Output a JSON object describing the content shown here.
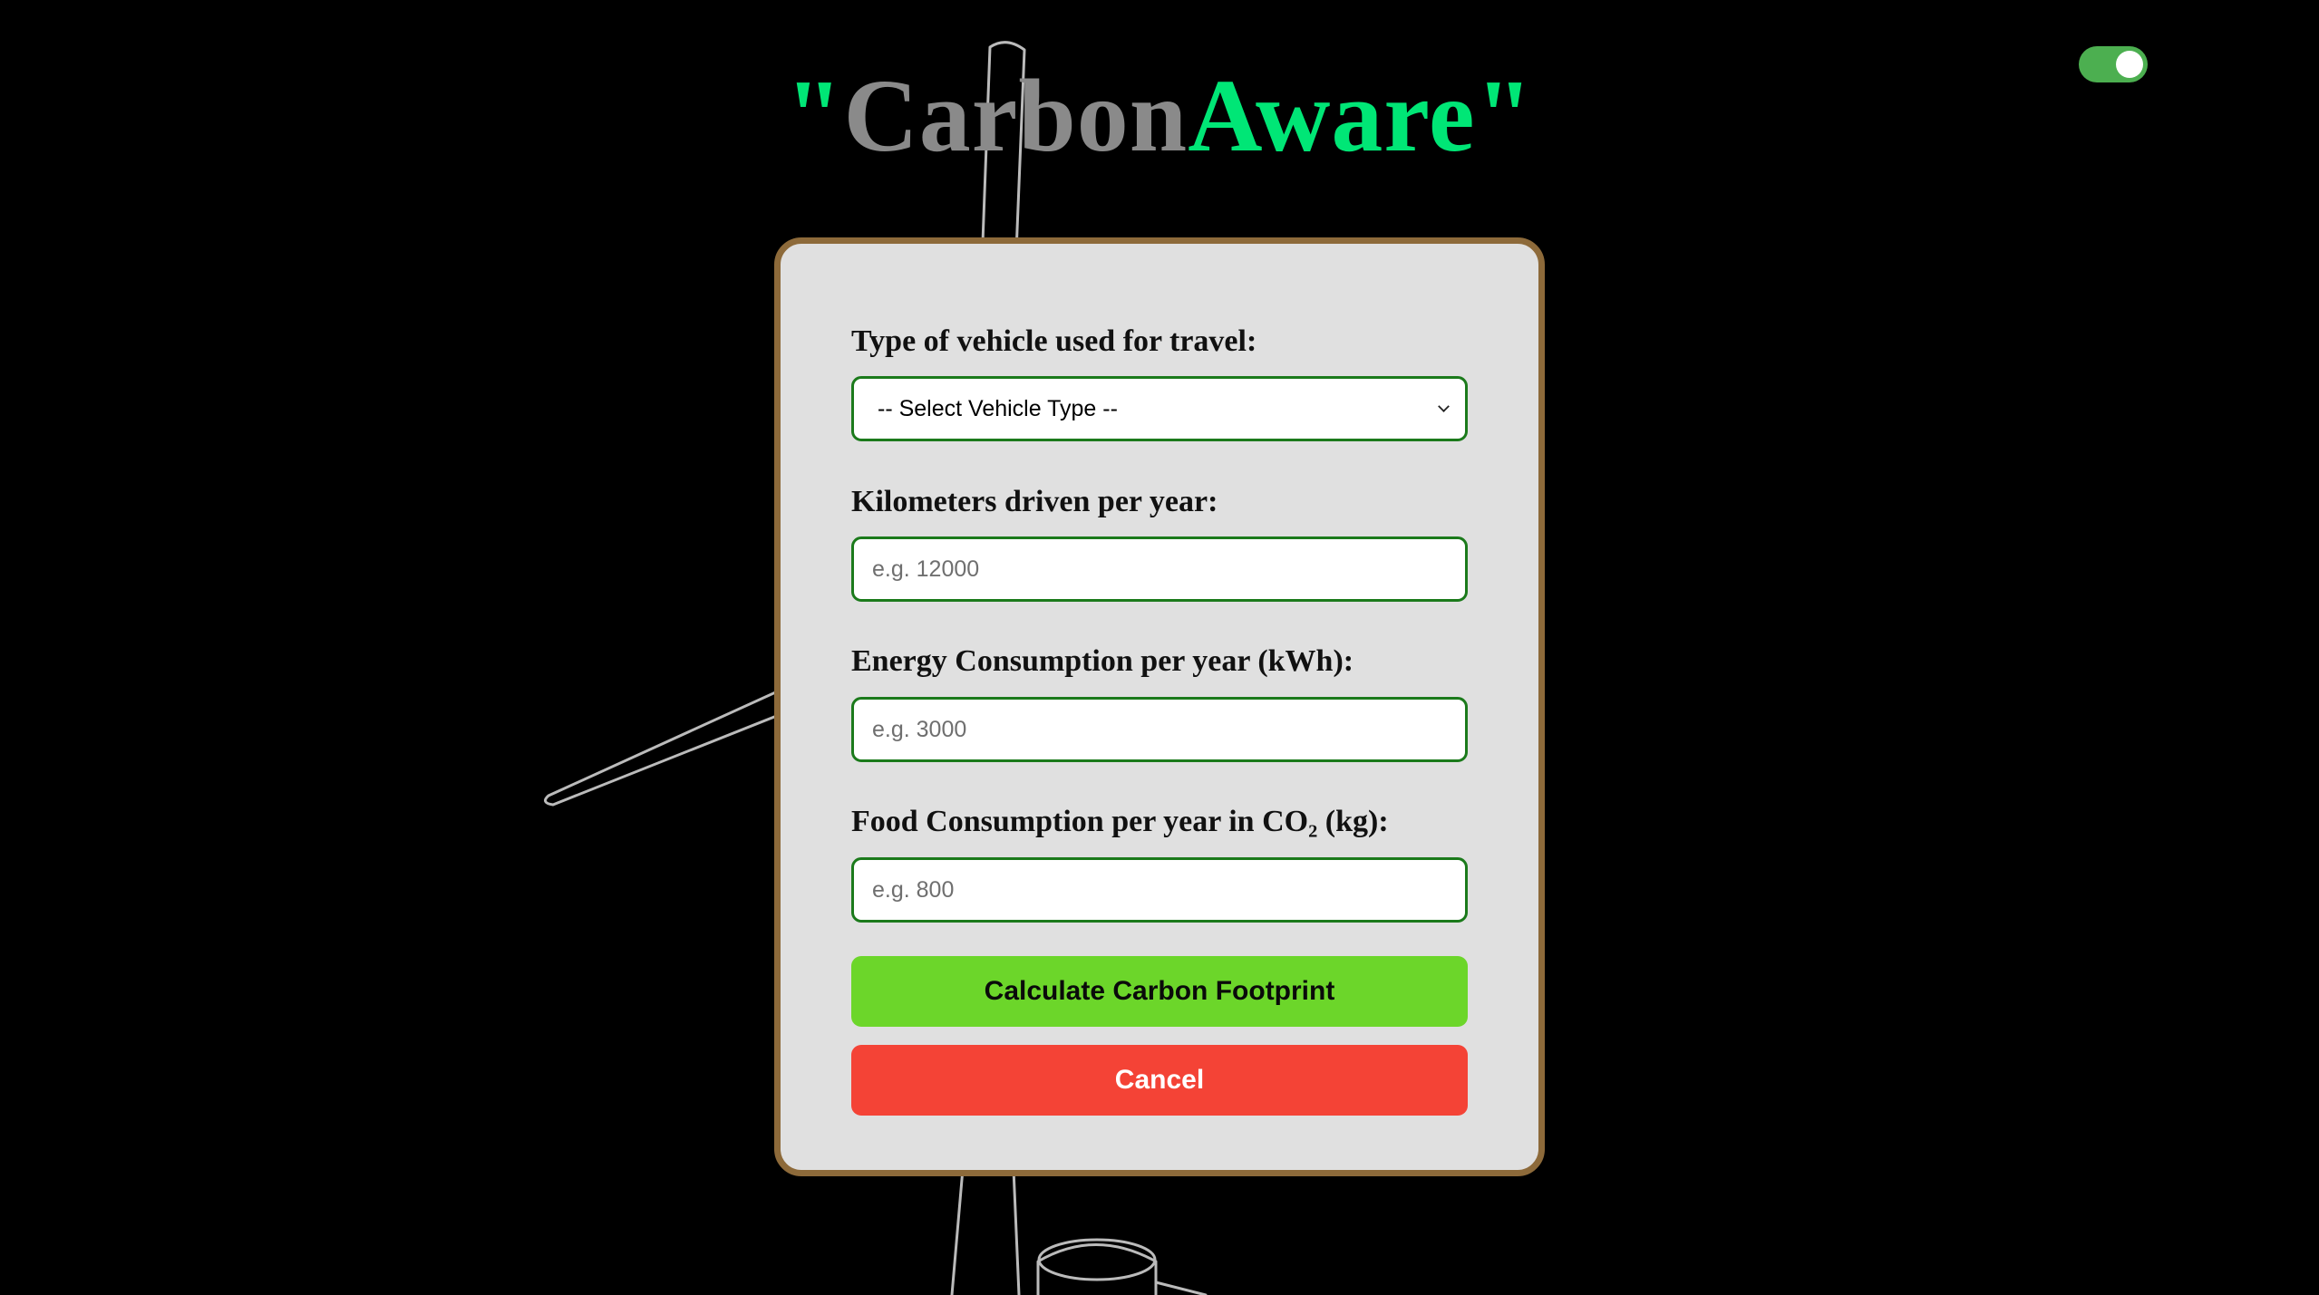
{
  "header": {
    "open_quote": "\"",
    "title_part1": "Carbon",
    "title_part2": "Aware",
    "close_quote": "\""
  },
  "theme_toggle": {
    "on": true
  },
  "form": {
    "vehicle": {
      "label": "Type of vehicle used for travel:",
      "selected": "-- Select Vehicle Type --"
    },
    "kilometers": {
      "label": "Kilometers driven per year:",
      "placeholder": "e.g. 12000"
    },
    "energy": {
      "label": "Energy Consumption per year (kWh):",
      "placeholder": "e.g. 3000"
    },
    "food": {
      "label": "Food Consumption per year in CO₂ (kg):",
      "placeholder": "e.g. 800"
    },
    "calculate_label": "Calculate Carbon Footprint",
    "cancel_label": "Cancel"
  },
  "colors": {
    "background": "#000000",
    "accent_green": "#00e676",
    "title_grey": "#8a8a8a",
    "card_bg": "#e0e0e0",
    "card_border": "#8d6a3a",
    "input_border": "#1b7a1b",
    "calculate_button": "#6cd62a",
    "cancel_button": "#f44336",
    "toggle_on": "#4caf50"
  }
}
